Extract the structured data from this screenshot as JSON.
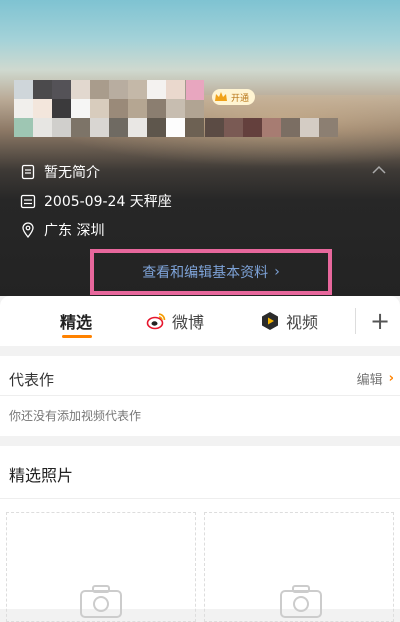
{
  "header": {
    "vip_badge": "开通",
    "bio": "暂无简介",
    "birthday": "2005-09-24 天秤座",
    "location": "广东 深圳",
    "edit_profile_link": "查看和编辑基本资料",
    "edit_profile_arrow": "›",
    "highlight_color": "#e7679c"
  },
  "tabs": [
    {
      "label": "精选",
      "icon": "none",
      "active": true
    },
    {
      "label": "微博",
      "icon": "weibo-icon"
    },
    {
      "label": "视频",
      "icon": "video-icon"
    }
  ],
  "tabs_add": "+",
  "representative": {
    "title": "代表作",
    "edit_label": "编辑",
    "empty_text": "你还没有添加视频代表作"
  },
  "photos": {
    "title": "精选照片"
  },
  "colors": {
    "accent": "#ff8200",
    "link": "#7ea3d8"
  }
}
